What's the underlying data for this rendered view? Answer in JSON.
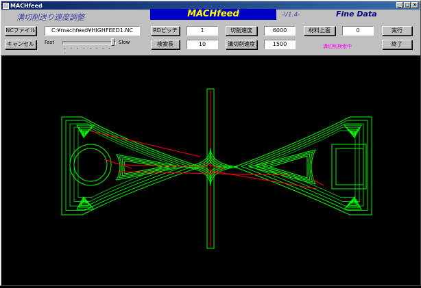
{
  "window": {
    "title": "MACHfeed",
    "minimize": "_",
    "maximize": "□",
    "close": "×"
  },
  "header": {
    "heading": "溝切削送り速度調整",
    "banner": "MACHfeed",
    "version": "-V1.4-",
    "fine_data": "Fine Data"
  },
  "toolbar": {
    "nc_file_button": "NCファイル",
    "file_path": "C:¥machfeed¥HIGHFEED1.NC",
    "rd_pitch_button": "RDピッチ",
    "rd_pitch_value": "1",
    "cut_speed_button": "切削速度",
    "cut_speed_value": "6000",
    "material_top_button": "材料上面",
    "material_top_value": "0",
    "run_button": "実行",
    "cancel_button": "キャンセル",
    "fast_label": "Fast",
    "slow_label": "Slow",
    "slider_level": 1.0,
    "search_length_button": "検索長",
    "search_length_value": "10",
    "groove_speed_button": "溝切削速度",
    "groove_speed_value": "1500",
    "status": "溝切削検索中",
    "exit_button": "終了"
  },
  "colors": {
    "toolpath": "#00ff00",
    "rapid": "#ff0000",
    "banner_bg": "#0000c8",
    "banner_text": "#ffff00"
  }
}
